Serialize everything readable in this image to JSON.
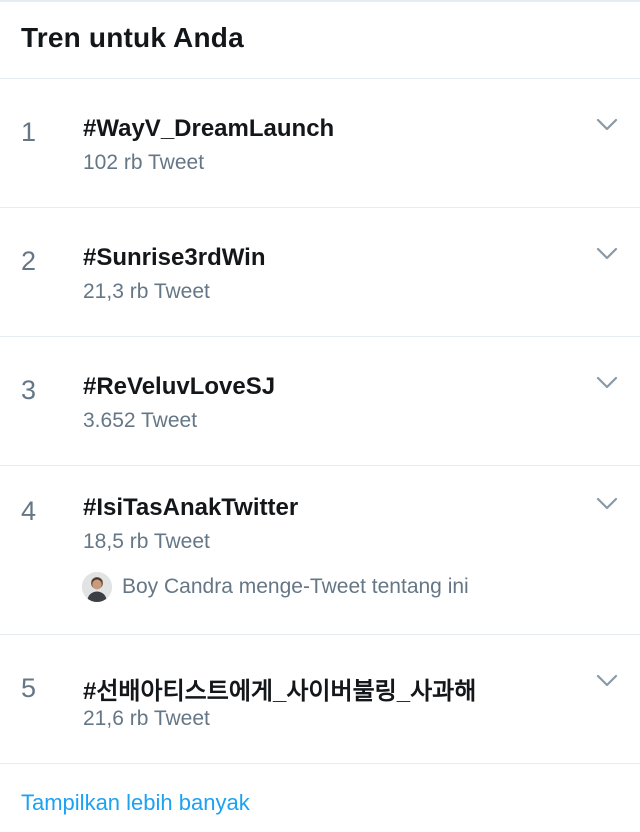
{
  "header": {
    "title": "Tren untuk Anda"
  },
  "trends": [
    {
      "rank": "1",
      "name": "#WayV_DreamLaunch",
      "count": "102 rb Tweet"
    },
    {
      "rank": "2",
      "name": "#Sunrise3rdWin",
      "count": "21,3 rb Tweet"
    },
    {
      "rank": "3",
      "name": "#ReVeluvLoveSJ",
      "count": "3.652 Tweet"
    },
    {
      "rank": "4",
      "name": "#IsiTasAnakTwitter",
      "count": "18,5 rb Tweet",
      "context": "Boy Candra menge-Tweet tentang ini"
    },
    {
      "rank": "5",
      "name": "#선배아티스트에게_사이버불링_사과해",
      "count": "21,6 rb Tweet"
    }
  ],
  "footer": {
    "show_more": "Tampilkan lebih banyak"
  },
  "colors": {
    "text_primary": "#14171a",
    "text_secondary": "#657786",
    "link": "#1da1f2",
    "divider": "#e6ecf0"
  },
  "icons": {
    "trend_menu": "chevron-down-icon",
    "context_avatar": "avatar"
  }
}
